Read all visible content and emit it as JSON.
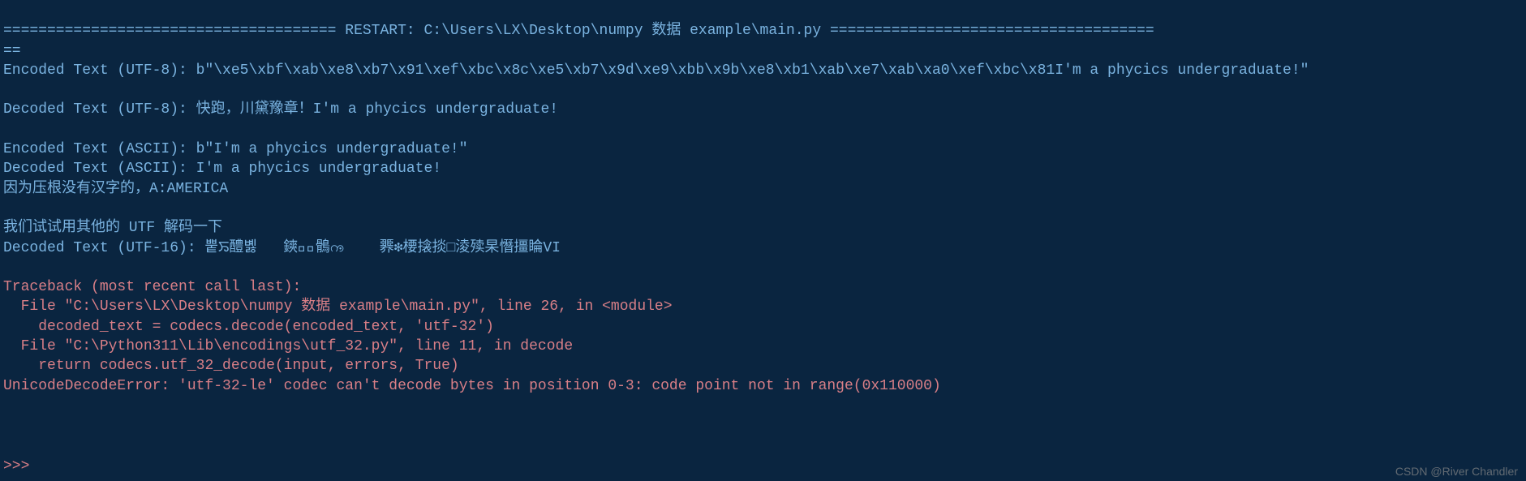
{
  "lines": {
    "restart_line": "====================================== RESTART: C:\\Users\\LX\\Desktop\\numpy 数据 example\\main.py =====================================\n==",
    "encoded_utf8": "Encoded Text (UTF-8): b\"\\xe5\\xbf\\xab\\xe8\\xb7\\x91\\xef\\xbc\\x8c\\xe5\\xb7\\x9d\\xe9\\xbb\\x9b\\xe8\\xb1\\xab\\xe7\\xab\\xa0\\xef\\xbc\\x81I'm a phycics undergraduate!\"",
    "decoded_utf8": "Decoded Text (UTF-8): 快跑，川黛豫章！I'm a phycics undergraduate!",
    "encoded_ascii": "Encoded Text (ASCII): b\"I'm a phycics undergraduate!\"",
    "decoded_ascii": "Decoded Text (ASCII): I'm a phycics undergraduate!",
    "note_chinese": "因为压根没有汉字的，A:AMERICA",
    "try_other": "我们试试用其他的 UTF 解码一下",
    "decoded_utf16": "Decoded Text (UTF-16): 뿥ꯢ醴볧   鏯믪ᷥ鶻ꧩ    臩❇楆搇掞□淩㱩杲憯㩖睔VI",
    "traceback_header": "Traceback (most recent call last):",
    "traceback_file1": "  File \"C:\\Users\\LX\\Desktop\\numpy 数据 example\\main.py\", line 26, in <module>",
    "traceback_code1": "    decoded_text = codecs.decode(encoded_text, 'utf-32')",
    "traceback_file2": "  File \"C:\\Python311\\Lib\\encodings\\utf_32.py\", line 11, in decode",
    "traceback_code2": "    return codecs.utf_32_decode(input, errors, True)",
    "error": "UnicodeDecodeError: 'utf-32-le' codec can't decode bytes in position 0-3: code point not in range(0x110000)"
  },
  "prompt": ">>>",
  "watermark": "CSDN @River Chandler"
}
